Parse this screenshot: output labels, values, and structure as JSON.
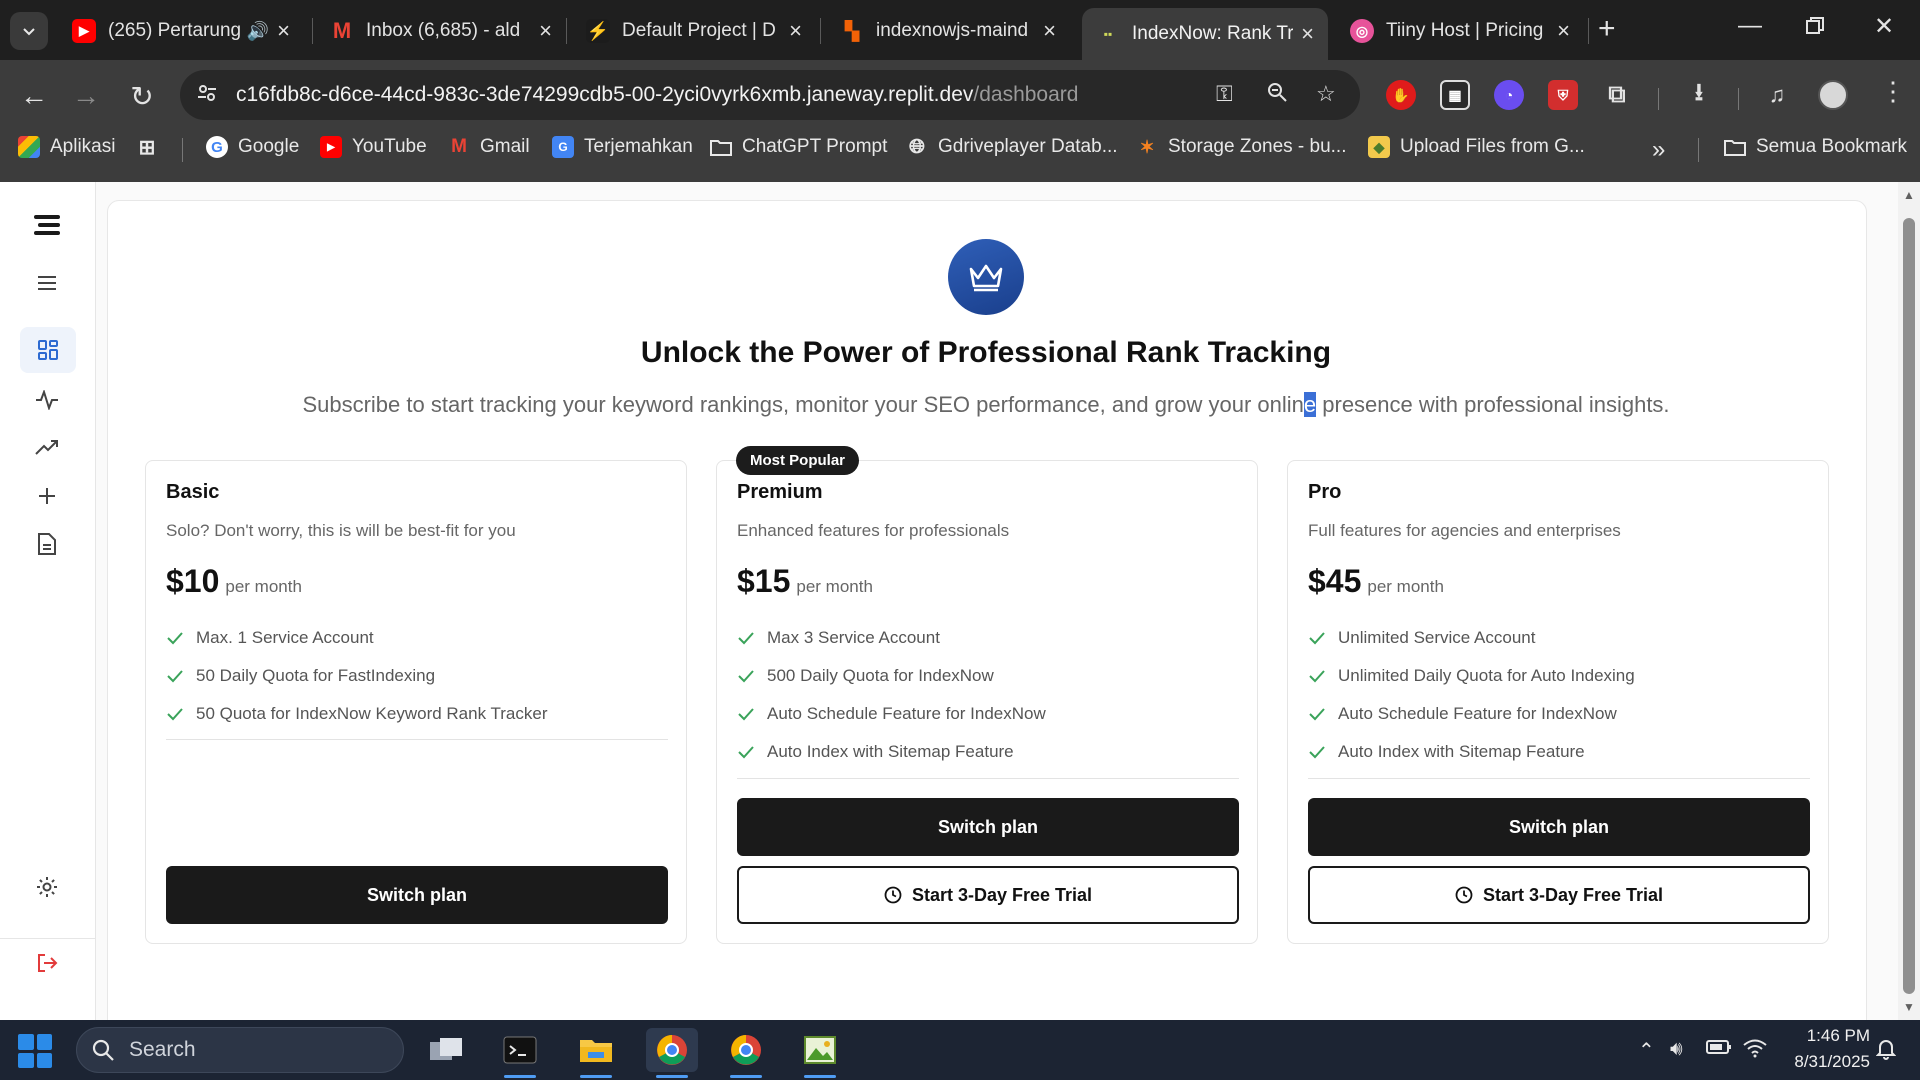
{
  "browser": {
    "tabs": [
      {
        "title": "(265) Pertarung",
        "favicon_color": "#ff0000",
        "favicon": "yt",
        "active": false,
        "audio": true
      },
      {
        "title": "Inbox (6,685) - ald",
        "favicon_color": "#ea4335",
        "favicon": "M",
        "active": false
      },
      {
        "title": "Default Project | D",
        "favicon_color": "#3ecf8e",
        "favicon": "⚡",
        "active": false
      },
      {
        "title": "indexnowjs-maind",
        "favicon_color": "#f26207",
        "favicon": "▚",
        "active": false
      },
      {
        "title": "IndexNow: Rank Tr",
        "favicon_color": "#3c3c3c",
        "favicon": "·",
        "active": true
      },
      {
        "title": "Tiiny Host | Pricing",
        "favicon_color": "#e7539a",
        "favicon": "◎",
        "active": false
      }
    ],
    "url_host": "c16fdb8c-d6ce-44cd-983c-3de74299cdb5-00-2yci0vyrk6xmb.janeway.replit.dev",
    "url_path": "/dashboard",
    "bookmarks": [
      {
        "label": "Aplikasi",
        "icon": "apps-grid-icon",
        "color": "#e8e8e8"
      },
      {
        "label": "Google",
        "icon": "google-icon",
        "color": "#4285f4"
      },
      {
        "label": "YouTube",
        "icon": "youtube-icon",
        "color": "#ff0000"
      },
      {
        "label": "Gmail",
        "icon": "gmail-icon",
        "color": "#ea4335"
      },
      {
        "label": "Terjemahkan",
        "icon": "translate-icon",
        "color": "#4285f4"
      },
      {
        "label": "ChatGPT Prompt",
        "icon": "folder-icon",
        "color": "#e8e8e8"
      },
      {
        "label": "Gdriveplayer Datab...",
        "icon": "globe-icon",
        "color": "#e8e8e8"
      },
      {
        "label": "Storage Zones - bu...",
        "icon": "bunny-icon",
        "color": "#f48120"
      },
      {
        "label": "Upload Files from G...",
        "icon": "cube-icon",
        "color": "#f2c94c"
      }
    ],
    "bookmarks_all": "Semua Bookmark"
  },
  "page": {
    "headline": "Unlock the Power of Professional Rank Tracking",
    "subline_before": "Subscribe to start tracking your keyword rankings, monitor your SEO performance, and grow your onlin",
    "subline_selected": "e",
    "subline_after": " presence with professional insights.",
    "badge": "Most Popular",
    "plans": [
      {
        "name": "Basic",
        "desc": "Solo? Don't worry, this is will be best-fit for you",
        "price": "$10",
        "period": "per month",
        "features": [
          "Max. 1 Service Account",
          "50 Daily Quota for FastIndexing",
          "50 Quota for IndexNow Keyword Rank Tracker"
        ],
        "primary_button": "Switch plan"
      },
      {
        "name": "Premium",
        "desc": "Enhanced features for professionals",
        "price": "$15",
        "period": "per month",
        "features": [
          "Max 3 Service Account",
          "500 Daily Quota for IndexNow",
          "Auto Schedule Feature for IndexNow",
          "Auto Index with Sitemap Feature"
        ],
        "primary_button": "Switch plan",
        "trial_button": "Start 3-Day Free Trial"
      },
      {
        "name": "Pro",
        "desc": "Full features for agencies and enterprises",
        "price": "$45",
        "period": "per month",
        "features": [
          "Unlimited Service Account",
          "Unlimited Daily Quota for Auto Indexing",
          "Auto Schedule Feature for IndexNow",
          "Auto Index with Sitemap Feature"
        ],
        "primary_button": "Switch plan",
        "trial_button": "Start 3-Day Free Trial"
      }
    ]
  },
  "taskbar": {
    "search_label": "Search",
    "time": "1:46 PM",
    "date": "8/31/2025"
  }
}
